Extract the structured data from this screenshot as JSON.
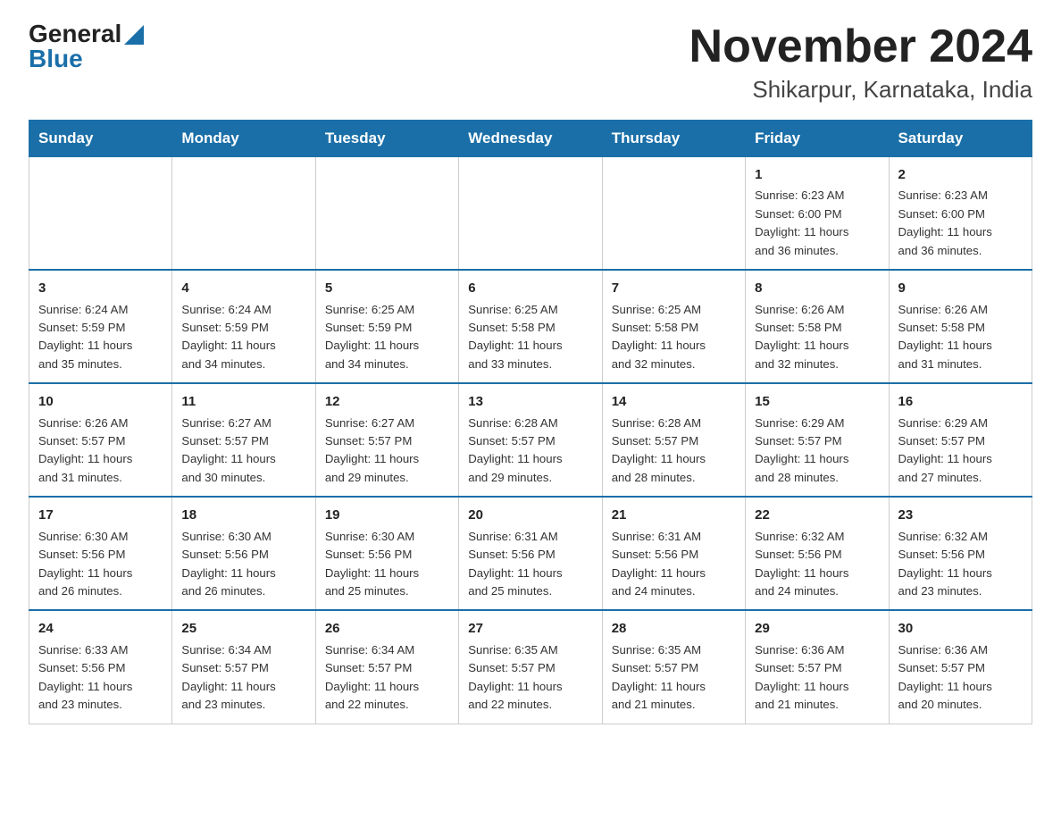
{
  "header": {
    "logo_general": "General",
    "logo_blue": "Blue",
    "month_title": "November 2024",
    "location": "Shikarpur, Karnataka, India"
  },
  "weekdays": [
    "Sunday",
    "Monday",
    "Tuesday",
    "Wednesday",
    "Thursday",
    "Friday",
    "Saturday"
  ],
  "weeks": [
    [
      {
        "day": "",
        "info": ""
      },
      {
        "day": "",
        "info": ""
      },
      {
        "day": "",
        "info": ""
      },
      {
        "day": "",
        "info": ""
      },
      {
        "day": "",
        "info": ""
      },
      {
        "day": "1",
        "info": "Sunrise: 6:23 AM\nSunset: 6:00 PM\nDaylight: 11 hours\nand 36 minutes."
      },
      {
        "day": "2",
        "info": "Sunrise: 6:23 AM\nSunset: 6:00 PM\nDaylight: 11 hours\nand 36 minutes."
      }
    ],
    [
      {
        "day": "3",
        "info": "Sunrise: 6:24 AM\nSunset: 5:59 PM\nDaylight: 11 hours\nand 35 minutes."
      },
      {
        "day": "4",
        "info": "Sunrise: 6:24 AM\nSunset: 5:59 PM\nDaylight: 11 hours\nand 34 minutes."
      },
      {
        "day": "5",
        "info": "Sunrise: 6:25 AM\nSunset: 5:59 PM\nDaylight: 11 hours\nand 34 minutes."
      },
      {
        "day": "6",
        "info": "Sunrise: 6:25 AM\nSunset: 5:58 PM\nDaylight: 11 hours\nand 33 minutes."
      },
      {
        "day": "7",
        "info": "Sunrise: 6:25 AM\nSunset: 5:58 PM\nDaylight: 11 hours\nand 32 minutes."
      },
      {
        "day": "8",
        "info": "Sunrise: 6:26 AM\nSunset: 5:58 PM\nDaylight: 11 hours\nand 32 minutes."
      },
      {
        "day": "9",
        "info": "Sunrise: 6:26 AM\nSunset: 5:58 PM\nDaylight: 11 hours\nand 31 minutes."
      }
    ],
    [
      {
        "day": "10",
        "info": "Sunrise: 6:26 AM\nSunset: 5:57 PM\nDaylight: 11 hours\nand 31 minutes."
      },
      {
        "day": "11",
        "info": "Sunrise: 6:27 AM\nSunset: 5:57 PM\nDaylight: 11 hours\nand 30 minutes."
      },
      {
        "day": "12",
        "info": "Sunrise: 6:27 AM\nSunset: 5:57 PM\nDaylight: 11 hours\nand 29 minutes."
      },
      {
        "day": "13",
        "info": "Sunrise: 6:28 AM\nSunset: 5:57 PM\nDaylight: 11 hours\nand 29 minutes."
      },
      {
        "day": "14",
        "info": "Sunrise: 6:28 AM\nSunset: 5:57 PM\nDaylight: 11 hours\nand 28 minutes."
      },
      {
        "day": "15",
        "info": "Sunrise: 6:29 AM\nSunset: 5:57 PM\nDaylight: 11 hours\nand 28 minutes."
      },
      {
        "day": "16",
        "info": "Sunrise: 6:29 AM\nSunset: 5:57 PM\nDaylight: 11 hours\nand 27 minutes."
      }
    ],
    [
      {
        "day": "17",
        "info": "Sunrise: 6:30 AM\nSunset: 5:56 PM\nDaylight: 11 hours\nand 26 minutes."
      },
      {
        "day": "18",
        "info": "Sunrise: 6:30 AM\nSunset: 5:56 PM\nDaylight: 11 hours\nand 26 minutes."
      },
      {
        "day": "19",
        "info": "Sunrise: 6:30 AM\nSunset: 5:56 PM\nDaylight: 11 hours\nand 25 minutes."
      },
      {
        "day": "20",
        "info": "Sunrise: 6:31 AM\nSunset: 5:56 PM\nDaylight: 11 hours\nand 25 minutes."
      },
      {
        "day": "21",
        "info": "Sunrise: 6:31 AM\nSunset: 5:56 PM\nDaylight: 11 hours\nand 24 minutes."
      },
      {
        "day": "22",
        "info": "Sunrise: 6:32 AM\nSunset: 5:56 PM\nDaylight: 11 hours\nand 24 minutes."
      },
      {
        "day": "23",
        "info": "Sunrise: 6:32 AM\nSunset: 5:56 PM\nDaylight: 11 hours\nand 23 minutes."
      }
    ],
    [
      {
        "day": "24",
        "info": "Sunrise: 6:33 AM\nSunset: 5:56 PM\nDaylight: 11 hours\nand 23 minutes."
      },
      {
        "day": "25",
        "info": "Sunrise: 6:34 AM\nSunset: 5:57 PM\nDaylight: 11 hours\nand 23 minutes."
      },
      {
        "day": "26",
        "info": "Sunrise: 6:34 AM\nSunset: 5:57 PM\nDaylight: 11 hours\nand 22 minutes."
      },
      {
        "day": "27",
        "info": "Sunrise: 6:35 AM\nSunset: 5:57 PM\nDaylight: 11 hours\nand 22 minutes."
      },
      {
        "day": "28",
        "info": "Sunrise: 6:35 AM\nSunset: 5:57 PM\nDaylight: 11 hours\nand 21 minutes."
      },
      {
        "day": "29",
        "info": "Sunrise: 6:36 AM\nSunset: 5:57 PM\nDaylight: 11 hours\nand 21 minutes."
      },
      {
        "day": "30",
        "info": "Sunrise: 6:36 AM\nSunset: 5:57 PM\nDaylight: 11 hours\nand 20 minutes."
      }
    ]
  ]
}
